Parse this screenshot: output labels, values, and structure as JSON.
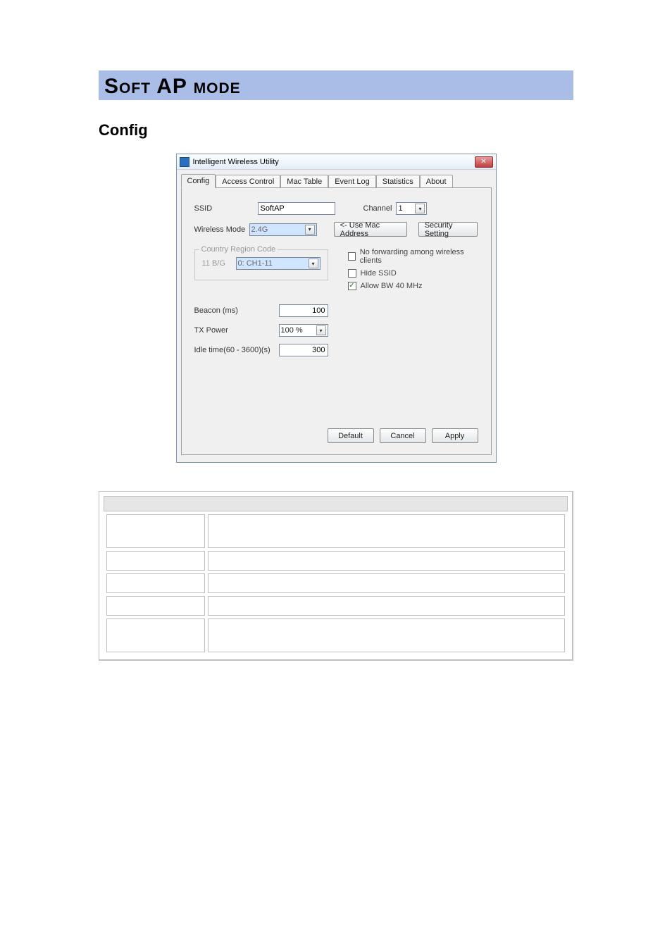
{
  "heading1": "Soft AP mode",
  "heading2": "Config",
  "window": {
    "title": "Intelligent Wireless Utility",
    "close_glyph": "✕",
    "tabs": [
      "Config",
      "Access Control",
      "Mac Table",
      "Event Log",
      "Statistics",
      "About"
    ],
    "ssid_label": "SSID",
    "ssid_value": "SoftAP",
    "channel_label": "Channel",
    "channel_value": "1",
    "wireless_mode_label": "Wireless Mode",
    "wireless_mode_value": "2.4G",
    "use_mac_btn": "<- Use Mac Address",
    "security_setting_btn": "Security Setting",
    "group_legend": "Country Region Code",
    "bg_label": "11 B/G",
    "bg_value": "0: CH1-11",
    "cb_noforward": "No forwarding among wireless clients",
    "cb_hide_ssid": "Hide SSID",
    "cb_allow_bw40": "Allow BW 40 MHz",
    "beacon_label": "Beacon (ms)",
    "beacon_value": "100",
    "txpower_label": "TX Power",
    "txpower_value": "100 %",
    "idle_label": "Idle time(60 - 3600)(s)",
    "idle_value": "300",
    "btn_default": "Default",
    "btn_cancel": "Cancel",
    "btn_apply": "Apply"
  },
  "desc": {
    "header": "",
    "rows": [
      {
        "k": "",
        "v": ""
      },
      {
        "k": "",
        "v": ""
      },
      {
        "k": "",
        "v": ""
      },
      {
        "k": "",
        "v": ""
      },
      {
        "k": "",
        "v": ""
      }
    ]
  }
}
